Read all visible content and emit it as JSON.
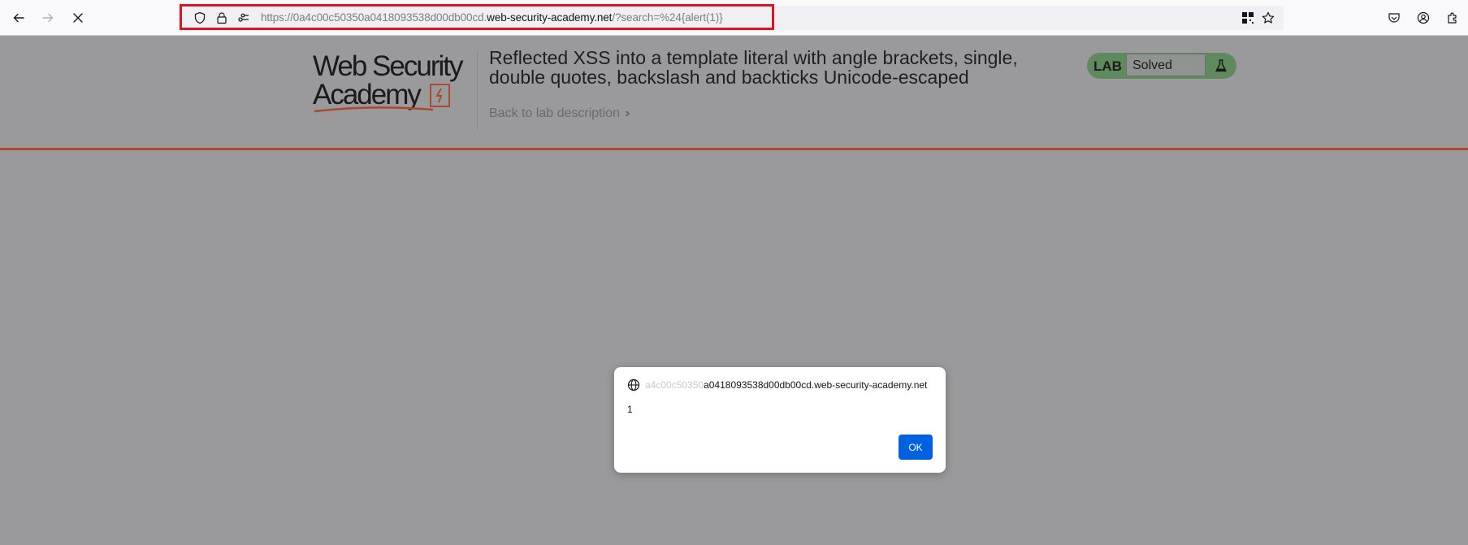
{
  "browser": {
    "url": {
      "scheme": "https://",
      "subdomain": "0a4c00c50350a0418093538d00db00cd.",
      "host": "web-security-academy.net",
      "path": "/?search=%24{alert(1)}"
    }
  },
  "lab": {
    "logo_line1": "Web Security",
    "logo_line2": "Academy",
    "title": "Reflected XSS into a template literal with angle brackets, single, double quotes, backslash and backticks Unicode-escaped",
    "back_link": "Back to lab description",
    "badge_label": "LAB",
    "status": "Solved"
  },
  "dialog": {
    "origin_faded": "a4c00c50350",
    "origin_rest": "a0418093538d00db00cd.web-security-academy.net",
    "message": "1",
    "ok_label": "OK"
  },
  "colors": {
    "accent_orange": "#a9492e",
    "lab_green": "#5e8a5e",
    "ok_blue": "#0061e0",
    "highlight_red": "#e0141e"
  }
}
